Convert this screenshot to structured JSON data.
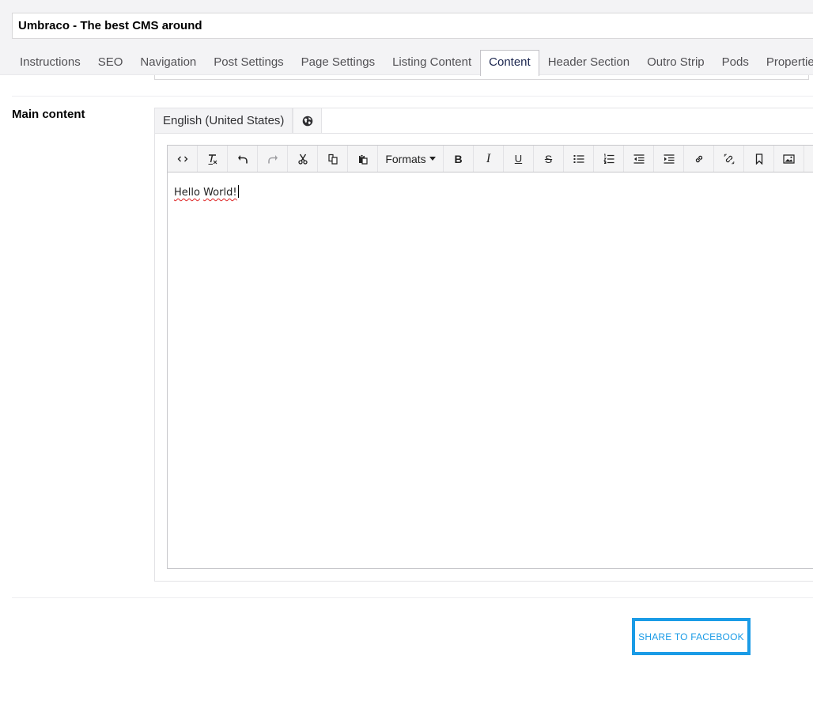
{
  "document": {
    "name_value": "Umbraco - The best CMS around"
  },
  "tabs": [
    {
      "label": "Instructions",
      "active": false
    },
    {
      "label": "SEO",
      "active": false
    },
    {
      "label": "Navigation",
      "active": false
    },
    {
      "label": "Post Settings",
      "active": false
    },
    {
      "label": "Page Settings",
      "active": false
    },
    {
      "label": "Listing Content",
      "active": false
    },
    {
      "label": "Content",
      "active": true
    },
    {
      "label": "Header Section",
      "active": false
    },
    {
      "label": "Outro Strip",
      "active": false
    },
    {
      "label": "Pods",
      "active": false
    },
    {
      "label": "Properties",
      "active": false
    }
  ],
  "property": {
    "label": "Main content",
    "language_tab": "English (United States)",
    "globe_icon": "globe-icon"
  },
  "toolbar": {
    "formats_label": "Formats",
    "bold_glyph": "B",
    "italic_glyph": "I",
    "underline_glyph": "U",
    "strike_glyph": "S",
    "buttons": [
      "source-code",
      "remove-format",
      "undo",
      "redo",
      "cut",
      "copy",
      "paste",
      "formats",
      "bold",
      "italic",
      "underline",
      "strikethrough",
      "bullet-list",
      "numbered-list",
      "outdent",
      "indent",
      "link",
      "unlink",
      "anchor",
      "image"
    ]
  },
  "editor": {
    "word1": "Hello",
    "word2": "World!"
  },
  "actions": {
    "share_label": "SHARE TO FACEBOOK"
  },
  "colors": {
    "accent": "#1a9be6",
    "header_bg": "#f3f3f5",
    "text": "#1b264f"
  }
}
